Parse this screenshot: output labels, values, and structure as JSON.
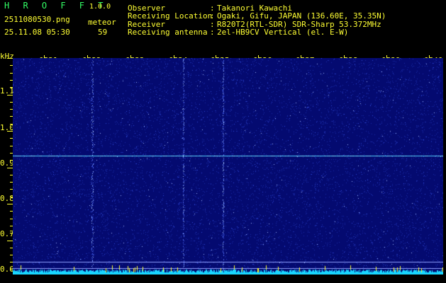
{
  "app": {
    "name": "H R O F F T",
    "version": "1.0.0"
  },
  "file": {
    "name": "2511080530.png",
    "datetime": "25.11.08 05:30"
  },
  "meteor": {
    "label": "meteor",
    "count": "59"
  },
  "info": [
    {
      "label": "Observer",
      "value": "Takanori Kawachi"
    },
    {
      "label": "Receiving Location",
      "value": "Ogaki, Gifu, JAPAN (136.60E, 35.35N)"
    },
    {
      "label": "Receiver",
      "value": "R820T2(RTL-SDR) SDR-Sharp 53.372MHz"
    },
    {
      "label": "Receiving antenna",
      "value": "2el-HB9CV Vertical (el. E-W)"
    }
  ],
  "axis": {
    "unit": "kHz",
    "x_labels": [
      "0531",
      "0532",
      "0533",
      "0534",
      "0535",
      "0536",
      "0537",
      "0538",
      "0539",
      "0540"
    ],
    "y_labels": [
      "1.1",
      "1.0",
      "0.9",
      "0.8",
      "0.7",
      "0.6"
    ]
  },
  "colors": {
    "background": "#000000",
    "plot": "#050a6e",
    "text": "#FFFF33",
    "title": "#33FF66"
  }
}
